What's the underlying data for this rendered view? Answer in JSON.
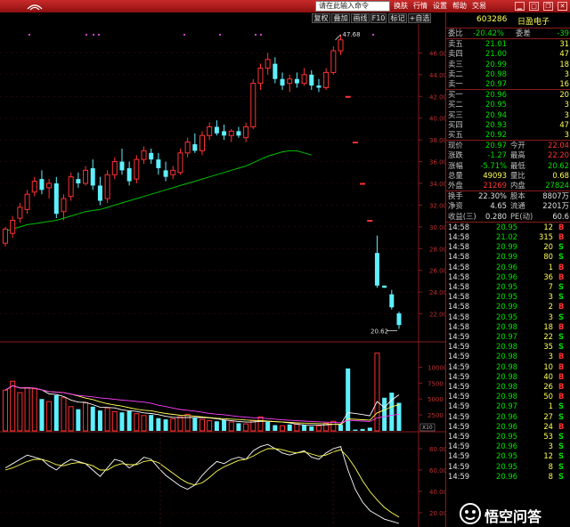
{
  "search_placeholder": "请在此输入命令",
  "menu": [
    "换肤",
    "行情",
    "设置",
    "帮助",
    "交易"
  ],
  "toolbar": [
    "复权",
    "叠加",
    "画线",
    "F10",
    "标记",
    "+自选"
  ],
  "stock": {
    "code": "603286",
    "name": "日盈电子"
  },
  "weibi": {
    "label1": "委比",
    "value1": "-20.42%",
    "label2": "委差",
    "value2": "-39"
  },
  "asks": [
    {
      "label": "卖五",
      "price": "21.01",
      "vol": "31"
    },
    {
      "label": "卖四",
      "price": "21.00",
      "vol": "47"
    },
    {
      "label": "卖三",
      "price": "20.99",
      "vol": "18"
    },
    {
      "label": "卖二",
      "price": "20.98",
      "vol": "3"
    },
    {
      "label": "卖一",
      "price": "20.97",
      "vol": "16"
    }
  ],
  "bids": [
    {
      "label": "买一",
      "price": "20.96",
      "vol": "20"
    },
    {
      "label": "买二",
      "price": "20.95",
      "vol": "3"
    },
    {
      "label": "买三",
      "price": "20.94",
      "vol": "3"
    },
    {
      "label": "买四",
      "price": "20.93",
      "vol": "47"
    },
    {
      "label": "买五",
      "price": "20.92",
      "vol": "3"
    }
  ],
  "quote": [
    {
      "l1": "现价",
      "v1": "20.97",
      "l2": "今开",
      "v2": "22.04"
    },
    {
      "l1": "涨跌",
      "v1": "-1.27",
      "l2": "最高",
      "v2": "22.20"
    },
    {
      "l1": "涨幅",
      "v1": "-5.71%",
      "l2": "最低",
      "v2": "20.62"
    },
    {
      "l1": "总量",
      "v1": "49093",
      "l2": "量比",
      "v2": "0.68"
    },
    {
      "l1": "外盘",
      "v1": "21269",
      "l2": "内盘",
      "v2": "27824"
    }
  ],
  "stats": [
    {
      "l1": "换手",
      "v1": "22.30%",
      "l2": "股本",
      "v2": "8807万"
    },
    {
      "l1": "净资",
      "v1": "4.65",
      "l2": "流通",
      "v2": "2201万"
    },
    {
      "l1": "收益(三)",
      "v1": "0.280",
      "l2": "PE(动)",
      "v2": "60.6"
    }
  ],
  "ticks": [
    {
      "time": "14:58",
      "price": "20.95",
      "vol": "12",
      "dir": "B"
    },
    {
      "time": "14:58",
      "price": "21.02",
      "vol": "315",
      "dir": "B"
    },
    {
      "time": "14:58",
      "price": "20.99",
      "vol": "20",
      "dir": "S"
    },
    {
      "time": "14:58",
      "price": "20.99",
      "vol": "80",
      "dir": "S"
    },
    {
      "time": "14:58",
      "price": "20.96",
      "vol": "1",
      "dir": "B"
    },
    {
      "time": "14:58",
      "price": "20.96",
      "vol": "36",
      "dir": "B"
    },
    {
      "time": "14:58",
      "price": "20.95",
      "vol": "7",
      "dir": "S"
    },
    {
      "time": "14:58",
      "price": "20.95",
      "vol": "3",
      "dir": "S"
    },
    {
      "time": "14:58",
      "price": "20.99",
      "vol": "2",
      "dir": "B"
    },
    {
      "time": "14:58",
      "price": "20.95",
      "vol": "3",
      "dir": "S"
    },
    {
      "time": "14:58",
      "price": "20.98",
      "vol": "18",
      "dir": "B"
    },
    {
      "time": "14:59",
      "price": "20.97",
      "vol": "22",
      "dir": "S"
    },
    {
      "time": "14:59",
      "price": "20.98",
      "vol": "35",
      "dir": "S"
    },
    {
      "time": "14:59",
      "price": "20.98",
      "vol": "3",
      "dir": "B"
    },
    {
      "time": "14:59",
      "price": "20.98",
      "vol": "10",
      "dir": "B"
    },
    {
      "time": "14:59",
      "price": "20.98",
      "vol": "40",
      "dir": "B"
    },
    {
      "time": "14:59",
      "price": "20.98",
      "vol": "26",
      "dir": "B"
    },
    {
      "time": "14:59",
      "price": "20.98",
      "vol": "50",
      "dir": "B"
    },
    {
      "time": "14:59",
      "price": "20.97",
      "vol": "1",
      "dir": "S"
    },
    {
      "time": "14:59",
      "price": "20.96",
      "vol": "27",
      "dir": "S"
    },
    {
      "time": "14:59",
      "price": "20.96",
      "vol": "24",
      "dir": "B"
    },
    {
      "time": "14:59",
      "price": "20.95",
      "vol": "53",
      "dir": "S"
    },
    {
      "time": "14:59",
      "price": "20.96",
      "vol": "3",
      "dir": "S"
    },
    {
      "time": "14:59",
      "price": "20.95",
      "vol": "12",
      "dir": "S"
    },
    {
      "time": "14:59",
      "price": "20.95",
      "vol": "8",
      "dir": "S"
    },
    {
      "time": "14:59",
      "price": "20.96",
      "vol": "8",
      "dir": "S"
    }
  ],
  "watermark": "悟空问答",
  "colors": {
    "up": "#ff3232",
    "down": "#5ef0ff",
    "ma": "#00c000",
    "frame": "#8b1a1a"
  },
  "chart_data": [
    {
      "type": "candlestick",
      "ylim": [
        20,
        48
      ],
      "yticks": [
        "46.00",
        "44.00",
        "42.00",
        "40.00",
        "38.00",
        "36.00",
        "34.00",
        "32.00",
        "30.00",
        "28.00",
        "26.00",
        "24.00",
        "22.00"
      ],
      "annotations": {
        "high": "47.68",
        "low": "20.62"
      },
      "candles": [
        {
          "o": 28.5,
          "h": 30.0,
          "l": 28.2,
          "c": 29.8
        },
        {
          "o": 29.4,
          "h": 31.0,
          "l": 29.0,
          "c": 30.6
        },
        {
          "o": 30.8,
          "h": 32.2,
          "l": 30.4,
          "c": 31.8
        },
        {
          "o": 31.6,
          "h": 33.4,
          "l": 31.2,
          "c": 33.0
        },
        {
          "o": 33.2,
          "h": 34.6,
          "l": 32.8,
          "c": 34.2
        },
        {
          "o": 34.4,
          "h": 35.2,
          "l": 33.0,
          "c": 33.4
        },
        {
          "o": 33.6,
          "h": 34.4,
          "l": 32.6,
          "c": 34.0
        },
        {
          "o": 34.0,
          "h": 34.6,
          "l": 30.8,
          "c": 31.2
        },
        {
          "o": 31.4,
          "h": 33.0,
          "l": 30.6,
          "c": 32.6
        },
        {
          "o": 32.8,
          "h": 35.0,
          "l": 32.4,
          "c": 34.6
        },
        {
          "o": 34.4,
          "h": 35.0,
          "l": 33.6,
          "c": 34.0
        },
        {
          "o": 34.0,
          "h": 35.6,
          "l": 33.8,
          "c": 35.2
        },
        {
          "o": 35.4,
          "h": 36.2,
          "l": 33.4,
          "c": 33.8
        },
        {
          "o": 33.8,
          "h": 34.6,
          "l": 32.0,
          "c": 32.4
        },
        {
          "o": 32.6,
          "h": 35.2,
          "l": 32.2,
          "c": 34.8
        },
        {
          "o": 34.8,
          "h": 36.4,
          "l": 34.4,
          "c": 36.0
        },
        {
          "o": 36.0,
          "h": 37.2,
          "l": 34.8,
          "c": 35.2
        },
        {
          "o": 35.4,
          "h": 36.0,
          "l": 33.8,
          "c": 34.2
        },
        {
          "o": 34.4,
          "h": 36.6,
          "l": 34.0,
          "c": 36.2
        },
        {
          "o": 36.2,
          "h": 37.4,
          "l": 35.8,
          "c": 37.0
        },
        {
          "o": 36.8,
          "h": 37.2,
          "l": 35.8,
          "c": 36.2
        },
        {
          "o": 36.2,
          "h": 36.8,
          "l": 34.8,
          "c": 35.4
        },
        {
          "o": 35.2,
          "h": 36.0,
          "l": 34.2,
          "c": 34.6
        },
        {
          "o": 34.8,
          "h": 35.6,
          "l": 34.4,
          "c": 35.2
        },
        {
          "o": 35.0,
          "h": 37.2,
          "l": 34.8,
          "c": 36.8
        },
        {
          "o": 36.8,
          "h": 38.2,
          "l": 36.4,
          "c": 37.8
        },
        {
          "o": 37.6,
          "h": 38.6,
          "l": 36.8,
          "c": 37.0
        },
        {
          "o": 37.0,
          "h": 38.8,
          "l": 36.6,
          "c": 38.4
        },
        {
          "o": 38.4,
          "h": 39.6,
          "l": 38.0,
          "c": 39.2
        },
        {
          "o": 39.2,
          "h": 39.8,
          "l": 38.4,
          "c": 38.6
        },
        {
          "o": 38.8,
          "h": 39.4,
          "l": 38.0,
          "c": 38.4
        },
        {
          "o": 38.4,
          "h": 39.0,
          "l": 37.8,
          "c": 38.8
        },
        {
          "o": 38.8,
          "h": 39.2,
          "l": 38.2,
          "c": 38.4
        },
        {
          "o": 38.2,
          "h": 39.6,
          "l": 37.8,
          "c": 39.2
        },
        {
          "o": 39.2,
          "h": 43.6,
          "l": 39.0,
          "c": 43.2
        },
        {
          "o": 43.2,
          "h": 45.0,
          "l": 42.6,
          "c": 44.6
        },
        {
          "o": 44.6,
          "h": 46.0,
          "l": 44.0,
          "c": 45.4
        },
        {
          "o": 45.0,
          "h": 45.6,
          "l": 43.2,
          "c": 43.6
        },
        {
          "o": 43.6,
          "h": 44.2,
          "l": 42.6,
          "c": 43.0
        },
        {
          "o": 43.2,
          "h": 44.0,
          "l": 42.4,
          "c": 43.6
        },
        {
          "o": 43.6,
          "h": 44.2,
          "l": 42.8,
          "c": 43.2
        },
        {
          "o": 43.2,
          "h": 44.6,
          "l": 43.0,
          "c": 44.0
        },
        {
          "o": 44.0,
          "h": 44.4,
          "l": 42.6,
          "c": 43.0
        },
        {
          "o": 43.0,
          "h": 43.6,
          "l": 42.4,
          "c": 42.8
        },
        {
          "o": 42.8,
          "h": 44.6,
          "l": 42.6,
          "c": 44.2
        },
        {
          "o": 44.2,
          "h": 46.6,
          "l": 44.0,
          "c": 46.2
        },
        {
          "o": 46.2,
          "h": 47.68,
          "l": 45.8,
          "c": 47.2
        },
        {
          "o": 42.0,
          "h": 42.0,
          "l": 42.0,
          "c": 42.0
        },
        {
          "o": 37.8,
          "h": 37.8,
          "l": 37.8,
          "c": 37.8
        },
        {
          "o": 34.0,
          "h": 34.0,
          "l": 34.0,
          "c": 34.0
        },
        {
          "o": 30.6,
          "h": 30.6,
          "l": 30.6,
          "c": 30.6
        },
        {
          "o": 27.6,
          "h": 29.2,
          "l": 24.4,
          "c": 24.6
        },
        {
          "o": 24.6,
          "h": 24.6,
          "l": 24.4,
          "c": 24.4
        },
        {
          "o": 23.8,
          "h": 24.2,
          "l": 22.4,
          "c": 22.6
        },
        {
          "o": 22.04,
          "h": 22.2,
          "l": 20.62,
          "c": 20.97
        }
      ],
      "ma": [
        29.6,
        29.8,
        30.0,
        30.2,
        30.3,
        30.4,
        30.5,
        30.6,
        30.8,
        31.0,
        31.2,
        31.4,
        31.5,
        31.6,
        31.8,
        32.0,
        32.2,
        32.4,
        32.6,
        32.8,
        33.0,
        33.2,
        33.4,
        33.6,
        33.8,
        34.0,
        34.2,
        34.4,
        34.6,
        34.8,
        35.0,
        35.2,
        35.4,
        35.6,
        35.9,
        36.2,
        36.5,
        36.7,
        36.9,
        37.0,
        37.0,
        36.8,
        36.6
      ]
    },
    {
      "type": "bar",
      "ylim": [
        0,
        13000
      ],
      "yticks": [
        "10000",
        "7500",
        "5000",
        "2500"
      ],
      "unit": "X10",
      "values": [
        6400,
        7800,
        6000,
        6800,
        6600,
        5000,
        4600,
        5600,
        5200,
        3800,
        3400,
        4400,
        3800,
        3200,
        3600,
        3000,
        2900,
        3100,
        2700,
        2400,
        2500,
        2000,
        1800,
        1900,
        2200,
        2600,
        2000,
        1800,
        1600,
        1500,
        1700,
        1400,
        1200,
        1100,
        1600,
        2200,
        1400,
        900,
        800,
        1000,
        1100,
        900,
        700,
        800,
        1200,
        1500,
        1000,
        9800,
        200,
        300,
        500,
        12200,
        5200,
        6000,
        4400
      ],
      "up": [
        true,
        true,
        true,
        true,
        true,
        false,
        true,
        false,
        true,
        true,
        false,
        true,
        false,
        false,
        true,
        true,
        false,
        false,
        true,
        true,
        false,
        false,
        false,
        true,
        true,
        true,
        false,
        true,
        true,
        false,
        false,
        true,
        false,
        true,
        true,
        true,
        false,
        false,
        true,
        false,
        true,
        false,
        false,
        true,
        true,
        true,
        false,
        false,
        false,
        false,
        false,
        true,
        false,
        false,
        false
      ]
    },
    {
      "type": "line",
      "yticks": [
        "80.00",
        "60.00",
        "40.00",
        "20.00"
      ],
      "ylim": [
        10,
        90
      ],
      "series": [
        {
          "color": "#ffffff",
          "values": [
            62,
            66,
            70,
            74,
            72,
            70,
            64,
            60,
            66,
            70,
            68,
            66,
            60,
            54,
            62,
            70,
            68,
            62,
            66,
            72,
            70,
            62,
            55,
            50,
            45,
            42,
            46,
            55,
            62,
            68,
            66,
            70,
            72,
            70,
            78,
            82,
            84,
            80,
            76,
            74,
            76,
            78,
            72,
            70,
            76,
            80,
            82,
            60,
            42,
            30,
            22,
            18,
            14,
            12,
            10
          ]
        },
        {
          "color": "#ffff55",
          "values": [
            60,
            62,
            65,
            68,
            70,
            70,
            68,
            65,
            64,
            66,
            67,
            66,
            64,
            60,
            60,
            64,
            66,
            65,
            65,
            68,
            69,
            67,
            62,
            57,
            52,
            48,
            46,
            48,
            53,
            59,
            63,
            66,
            69,
            70,
            73,
            77,
            80,
            80,
            79,
            77,
            76,
            77,
            75,
            73,
            74,
            77,
            79,
            72,
            62,
            50,
            40,
            32,
            25,
            20,
            16
          ]
        }
      ]
    }
  ]
}
